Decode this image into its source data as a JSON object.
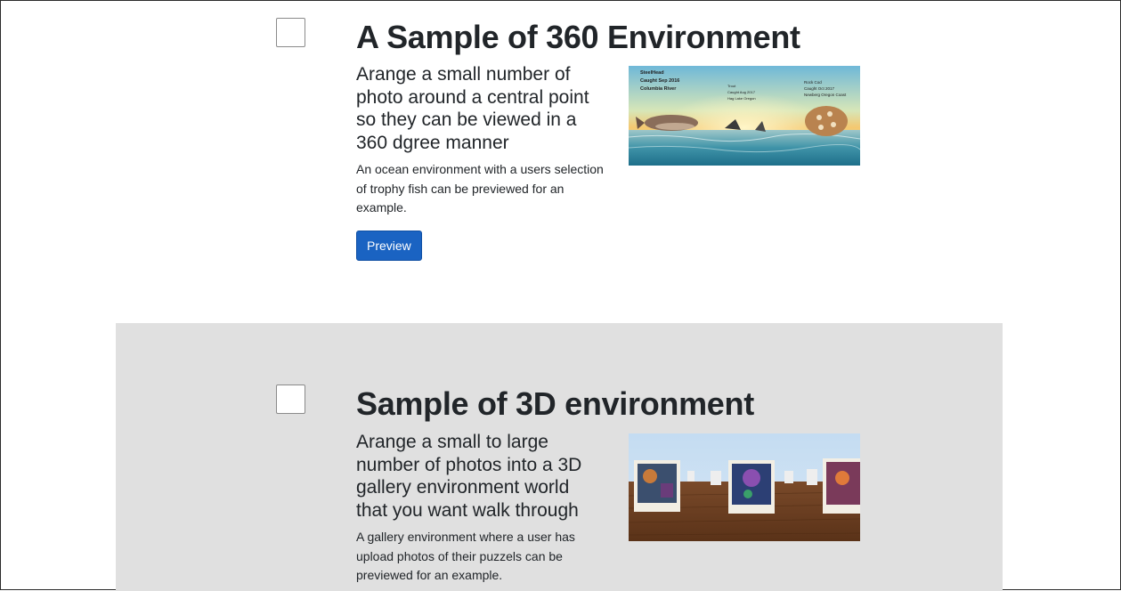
{
  "cards": [
    {
      "title": "A Sample of 360 Environment",
      "subtitle": "Arange a small number of photo around a central point so they can be viewed in a 360 dgree manner",
      "description": "An ocean environment with a users selection of trophy fish can be previewed for an example.",
      "button_label": "Preview",
      "image": {
        "captions": [
          {
            "line1": "SteelHead",
            "line2": "Caught Sep 2016",
            "line3": "Columbia River"
          },
          {
            "line1": "Trout",
            "line2": "Caught Aug 2017",
            "line3": "Hag Lake Oregon"
          },
          {
            "line1": "Rock Cod",
            "line2": "Caught Oct 2017",
            "line3": "Newberg Oregon Coast"
          }
        ]
      }
    },
    {
      "title": "Sample of 3D environment",
      "subtitle": "Arange a small to large number of photos into a 3D gallery environment world that you want walk through",
      "description": "A gallery environment where a user has upload photos of their puzzels can be previewed for an example."
    }
  ]
}
